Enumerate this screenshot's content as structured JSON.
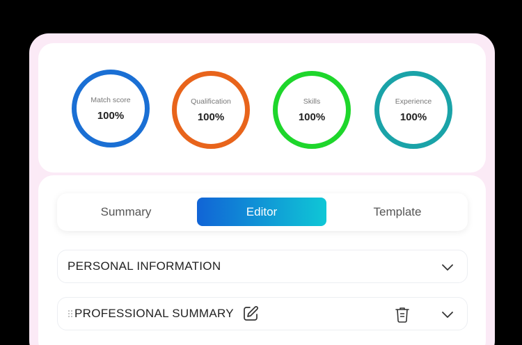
{
  "scores": [
    {
      "label": "Match score",
      "value": "100%",
      "color": "#1a6fd4"
    },
    {
      "label": "Qualification",
      "value": "100%",
      "color": "#e8641b"
    },
    {
      "label": "Skills",
      "value": "100%",
      "color": "#1ed62b"
    },
    {
      "label": "Experience",
      "value": "100%",
      "color": "#1aa3a8"
    }
  ],
  "tabs": {
    "summary": "Summary",
    "editor": "Editor",
    "template": "Template",
    "active": "editor"
  },
  "sections": {
    "personal": {
      "title": "PERSONAL INFORMATION",
      "icon": "chevron-down-icon"
    },
    "professional": {
      "title": "PROFESSIONAL SUMMARY",
      "icons": [
        "drag-handle-icon",
        "edit-icon",
        "trash-icon",
        "chevron-down-icon"
      ]
    }
  }
}
